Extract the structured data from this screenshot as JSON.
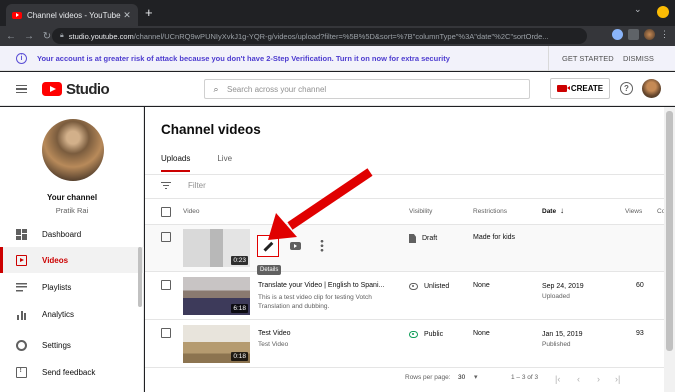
{
  "browser": {
    "tab_title": "Channel videos - YouTube Studio",
    "new_tab": "+",
    "url_host": "studio.youtube.com",
    "url_path": "/channel/UCnRQ9wPUNIyXvkJ1g-YQR-g/videos/upload?filter=%5B%5D&sort=%7B\"columnType\"%3A\"date\"%2C\"sortOrde..."
  },
  "banner": {
    "message": "Your account is at greater risk of attack because you don't have 2-Step Verification. Turn it on now for extra security",
    "get_started": "GET STARTED",
    "dismiss": "DISMISS"
  },
  "header": {
    "logo_text": "Studio",
    "search_placeholder": "Search across your channel",
    "create_label": "CREATE",
    "help": "?"
  },
  "sidebar": {
    "channel_label": "Your channel",
    "channel_name": "Pratik Rai",
    "items": [
      {
        "label": "Dashboard",
        "icon": "dashboard-icon"
      },
      {
        "label": "Videos",
        "icon": "videos-icon",
        "active": true
      },
      {
        "label": "Playlists",
        "icon": "playlists-icon"
      },
      {
        "label": "Analytics",
        "icon": "analytics-icon"
      },
      {
        "label": "Settings",
        "icon": "settings-icon"
      },
      {
        "label": "Send feedback",
        "icon": "feedback-icon"
      }
    ]
  },
  "main": {
    "title": "Channel videos",
    "tabs": [
      "Uploads",
      "Live"
    ],
    "filter_placeholder": "Filter",
    "columns": {
      "video": "Video",
      "visibility": "Visibility",
      "restrictions": "Restrictions",
      "date": "Date",
      "views": "Views",
      "comments": "Co"
    },
    "tooltip": "Details",
    "rows": [
      {
        "title": "",
        "description": "",
        "duration": "0:23",
        "visibility": "Draft",
        "restrictions": "Made for kids",
        "date": "",
        "date_status": "",
        "views": ""
      },
      {
        "title": "Translate your Video | English to Spani...",
        "description": "This is a test video clip for testing Votch Translation and dubbing.",
        "duration": "6:18",
        "visibility": "Unlisted",
        "restrictions": "None",
        "date": "Sep 24, 2019",
        "date_status": "Uploaded",
        "views": "60"
      },
      {
        "title": "Test Video",
        "description": "Test Video",
        "duration": "0:18",
        "visibility": "Public",
        "restrictions": "None",
        "date": "Jan 15, 2019",
        "date_status": "Published",
        "views": "93"
      }
    ],
    "footer": {
      "rows_per_page_label": "Rows per page:",
      "rows_per_page_value": "30",
      "range": "1 – 3 of 3"
    }
  },
  "colors": {
    "accent": "#cc0000",
    "banner_text": "#4d3ccf",
    "annotation_arrow": "#e00000"
  }
}
